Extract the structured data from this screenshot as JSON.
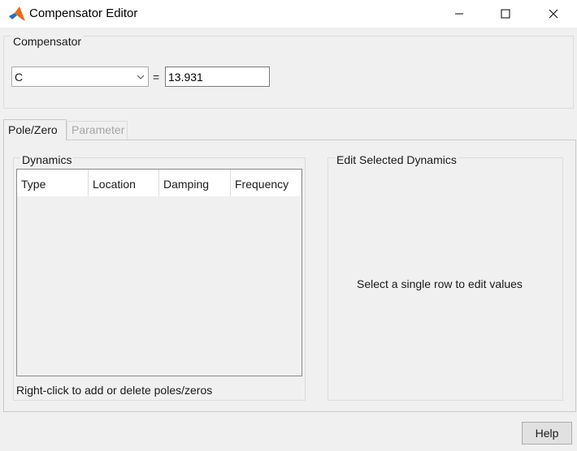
{
  "window": {
    "title": "Compensator Editor",
    "icons": {
      "app": "matlab-logo-icon",
      "minimize": "minimize-icon",
      "maximize": "maximize-icon",
      "close": "close-icon"
    }
  },
  "compensator": {
    "group_label": "Compensator",
    "selected": "C",
    "equals": "=",
    "value": "13.931"
  },
  "tabs": [
    {
      "label": "Pole/Zero",
      "active": true
    },
    {
      "label": "Parameter",
      "active": false
    }
  ],
  "dynamics": {
    "group_label": "Dynamics",
    "columns": [
      "Type",
      "Location",
      "Damping",
      "Frequency"
    ],
    "rows": [],
    "hint": "Right-click to add or delete poles/zeros"
  },
  "edit_panel": {
    "group_label": "Edit Selected Dynamics",
    "message": "Select a single row to edit values"
  },
  "footer": {
    "help_label": "Help"
  }
}
